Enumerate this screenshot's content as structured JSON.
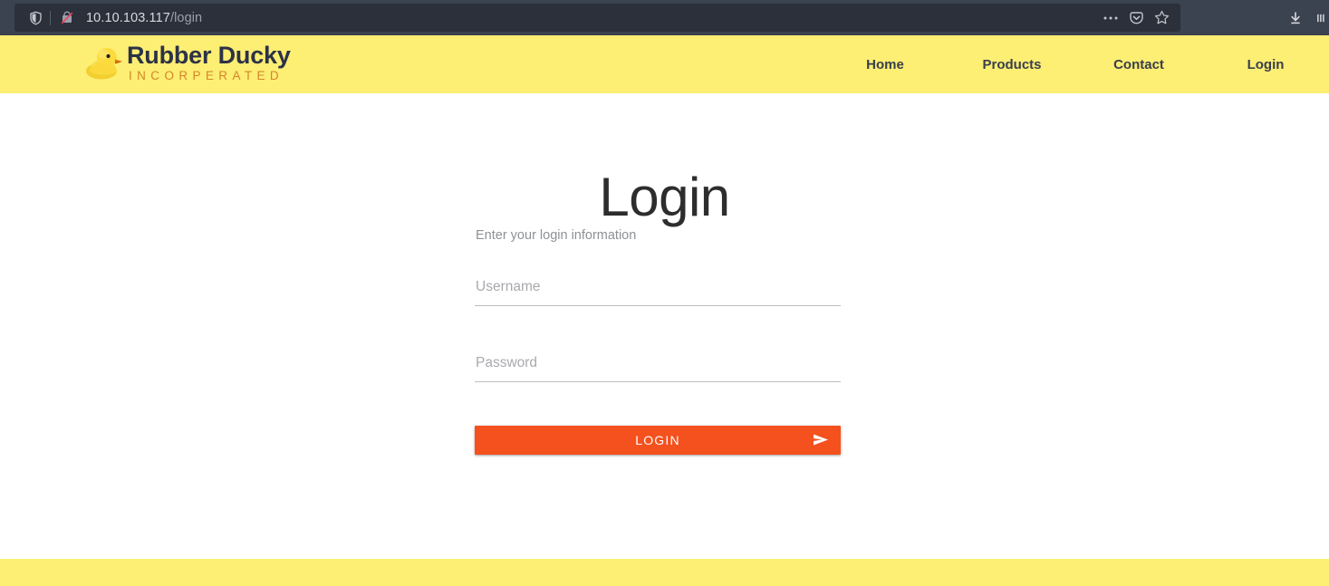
{
  "browser": {
    "url_host": "10.10.103.117",
    "url_path": "/login",
    "icons": {
      "shield": "shield-icon",
      "insecure": "insecure-connection-icon",
      "page_actions": "ellipsis-icon",
      "pocket": "pocket-icon",
      "bookmark": "star-icon",
      "downloads": "download-icon",
      "library": "library-icon"
    }
  },
  "header": {
    "brand_name": "Rubber Ducky",
    "brand_sub": "INCORPERATED",
    "logo_icon": "rubber-duck-icon",
    "nav": [
      {
        "label": "Home"
      },
      {
        "label": "Products"
      },
      {
        "label": "Contact"
      },
      {
        "label": "Login"
      }
    ],
    "background_color": "#FDEE74",
    "brand_name_color": "#2C3246",
    "brand_sub_color": "#D4852A"
  },
  "main": {
    "title": "Login",
    "hint": "Enter your login information",
    "fields": [
      {
        "name": "username",
        "placeholder": "Username",
        "value": ""
      },
      {
        "name": "password",
        "placeholder": "Password",
        "value": ""
      }
    ],
    "submit": {
      "label": "LOGIN",
      "icon": "send-arrow-icon",
      "color": "#F4511E"
    }
  },
  "footer": {
    "background_color": "#FDEE74"
  }
}
